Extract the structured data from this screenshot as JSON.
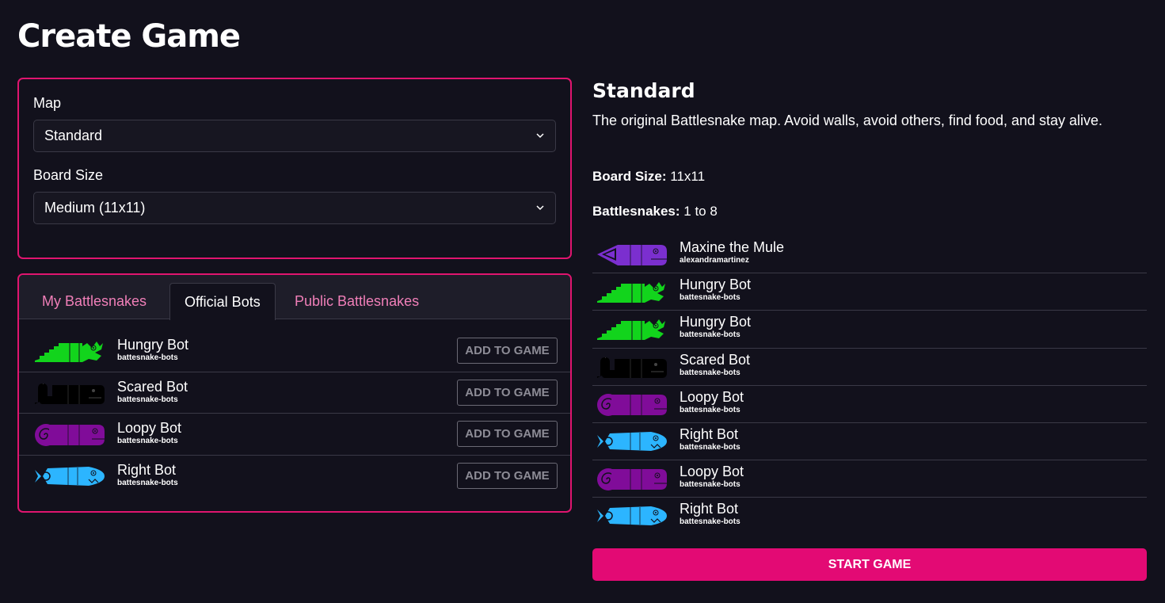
{
  "page": {
    "title": "Create Game"
  },
  "settings": {
    "map_label": "Map",
    "map_value": "Standard",
    "board_label": "Board Size",
    "board_value": "Medium (11x11)"
  },
  "tabs": [
    {
      "label": "My Battlesnakes",
      "active": false
    },
    {
      "label": "Official Bots",
      "active": true
    },
    {
      "label": "Public Battlesnakes",
      "active": false
    }
  ],
  "available_bots": [
    {
      "name": "Hungry Bot",
      "author": "battesnake-bots",
      "snake_icon": "hungry-snake",
      "color": "#12d41c",
      "action": "ADD TO GAME"
    },
    {
      "name": "Scared Bot",
      "author": "battesnake-bots",
      "snake_icon": "scared-snake",
      "color": "#000000",
      "action": "ADD TO GAME"
    },
    {
      "name": "Loopy Bot",
      "author": "battesnake-bots",
      "snake_icon": "loopy-snake",
      "color": "#800c99",
      "action": "ADD TO GAME"
    },
    {
      "name": "Right Bot",
      "author": "battesnake-bots",
      "snake_icon": "right-snake",
      "color": "#2cb5ff",
      "action": "ADD TO GAME"
    }
  ],
  "detail": {
    "title": "Standard",
    "description": "The original Battlesnake map. Avoid walls, avoid others, find food, and stay alive.",
    "board_size_label": "Board Size:",
    "board_size_value": " 11x11",
    "snakes_label": "Battlesnakes:",
    "snakes_value": " 1 to 8"
  },
  "game_snakes": [
    {
      "name": "Maxine the Mule",
      "author": "alexandramartinez",
      "snake_icon": "maxine-snake",
      "color": "#7b2fcf"
    },
    {
      "name": "Hungry Bot",
      "author": "battesnake-bots",
      "snake_icon": "hungry-snake",
      "color": "#12d41c"
    },
    {
      "name": "Hungry Bot",
      "author": "battesnake-bots",
      "snake_icon": "hungry-snake",
      "color": "#12d41c"
    },
    {
      "name": "Scared Bot",
      "author": "battesnake-bots",
      "snake_icon": "scared-snake",
      "color": "#000000"
    },
    {
      "name": "Loopy Bot",
      "author": "battesnake-bots",
      "snake_icon": "loopy-snake",
      "color": "#800c99"
    },
    {
      "name": "Right Bot",
      "author": "battesnake-bots",
      "snake_icon": "right-snake",
      "color": "#2cb5ff"
    },
    {
      "name": "Loopy Bot",
      "author": "battesnake-bots",
      "snake_icon": "loopy-snake",
      "color": "#800c99"
    },
    {
      "name": "Right Bot",
      "author": "battesnake-bots",
      "snake_icon": "right-snake",
      "color": "#2cb5ff"
    }
  ],
  "start_button": "START GAME",
  "colors": {
    "accent": "#e30a74",
    "panel_border": "#e0156f",
    "tab_inactive": "#f07fb8",
    "background": "#12111c"
  }
}
